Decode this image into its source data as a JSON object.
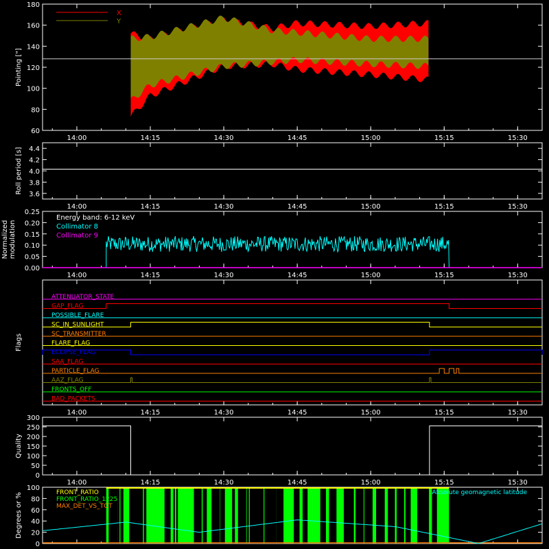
{
  "colors": {
    "axis": "#ffffff",
    "x": "#ff0000",
    "y": "#808000",
    "cyan": "#00ffff",
    "magenta": "#ff00ff",
    "green": "#00ff00",
    "yellow": "#ffff00",
    "orange": "#ff8000"
  },
  "time_ticks": [
    "14:00",
    "14:15",
    "14:30",
    "14:45",
    "15:00",
    "15:15",
    "15:30"
  ],
  "chart_data": [
    {
      "type": "line",
      "id": "pointing",
      "ylabel": "Pointing [\"]",
      "ylim": [
        60,
        180
      ],
      "yticks": [
        60,
        80,
        100,
        120,
        140,
        160,
        180
      ],
      "legend": [
        "X",
        "Y"
      ],
      "legend_placement": "top-left",
      "reference_level": 128,
      "data_range": [
        "14:11",
        "15:12"
      ],
      "series": [
        {
          "name": "X",
          "x": [
            "14:11",
            "14:15",
            "14:30",
            "14:40",
            "14:45",
            "15:00",
            "15:12"
          ],
          "min": [
            70,
            90,
            118,
            120,
            115,
            110,
            105
          ],
          "max": [
            155,
            150,
            168,
            160,
            165,
            162,
            165
          ]
        },
        {
          "name": "Y",
          "x": [
            "14:11",
            "14:15",
            "14:30",
            "14:40",
            "14:45",
            "15:00",
            "15:12"
          ],
          "min": [
            85,
            100,
            118,
            122,
            124,
            120,
            118
          ],
          "max": [
            150,
            152,
            170,
            158,
            156,
            150,
            150
          ]
        }
      ]
    },
    {
      "type": "line",
      "id": "roll",
      "ylabel": "Roll period [s]",
      "ylim": [
        3.5,
        4.5
      ],
      "yticks": [
        "3.6",
        "3.8",
        "4.0",
        "4.2",
        "4.4"
      ],
      "value": 4.03
    },
    {
      "type": "line",
      "id": "modulation",
      "ylabel": "Normalized modulation",
      "ylabel_lines": [
        "Normalized",
        "modulation"
      ],
      "ylim": [
        0,
        0.25
      ],
      "yticks": [
        "0.00",
        "0.05",
        "0.10",
        "0.15",
        "0.20",
        "0.25"
      ],
      "annotation": "Energy band: 6-12 keV",
      "series": [
        {
          "name": "Collimator 8",
          "x": [
            "14:06",
            "15:16"
          ],
          "mean": 0.105,
          "spread": 0.035
        },
        {
          "name": "Collimator 9",
          "value": 0
        }
      ]
    },
    {
      "type": "line",
      "id": "flags",
      "ylabel": "Flags",
      "series": [
        {
          "name": "ATTENUATOR_STATE",
          "color": "#ff00ff",
          "steps": []
        },
        {
          "name": "GAP_FLAG",
          "color": "#ff0000",
          "steps": [
            [
              "14:06",
              "15:16"
            ]
          ]
        },
        {
          "name": "POSSIBLE_FLARE",
          "color": "#00ffff",
          "steps": []
        },
        {
          "name": "SC_IN_SUNLIGHT",
          "color": "#ffff00",
          "steps": [
            [
              "14:11",
              "15:12"
            ]
          ]
        },
        {
          "name": "SC_TRANSMITTER",
          "color": "#ff8000",
          "steps": []
        },
        {
          "name": "FLARE_FLAG",
          "color": "#ffff00",
          "steps": []
        },
        {
          "name": "ECLIPSE_FLAG",
          "color": "#0000ff",
          "steps": [
            [
              "00:00",
              "14:11"
            ],
            [
              "15:12",
              "23:59"
            ]
          ]
        },
        {
          "name": "SAA_FLAG",
          "color": "#ff0000",
          "steps": []
        },
        {
          "name": "PARTICLE_FLAG",
          "color": "#ff8000",
          "steps": [
            [
              "15:14",
              "15:15"
            ],
            [
              "15:16",
              "15:17"
            ],
            [
              "15:17.5",
              "15:18"
            ]
          ]
        },
        {
          "name": "AAZ_FLAG",
          "color": "#808000",
          "steps": [
            [
              "14:11",
              "14:11.3"
            ],
            [
              "15:12",
              "15:12.3"
            ]
          ]
        },
        {
          "name": "FRONTS_OFF",
          "color": "#00ff00",
          "steps": []
        },
        {
          "name": "BAD_PACKETS",
          "color": "#ff0000",
          "steps": []
        }
      ]
    },
    {
      "type": "line",
      "id": "quality",
      "ylabel": "Quality",
      "ylim": [
        0,
        300
      ],
      "yticks": [
        0,
        50,
        100,
        150,
        200,
        250,
        300
      ],
      "series": [
        {
          "name": "Quality",
          "high": 255,
          "low_range": [
            "14:11",
            "15:12"
          ]
        }
      ]
    },
    {
      "type": "area",
      "id": "degrees",
      "ylabel": "Degrees or %",
      "ylim": [
        0,
        100
      ],
      "yticks": [
        0,
        20,
        40,
        60,
        80,
        100
      ],
      "legend": [
        "FRONT_RATIO",
        "FRONT_RATIO_1225",
        "MAX_DET_VS_TOT"
      ],
      "legend_right": "Absolute geomagnetic latitude",
      "front_ratio_range": [
        "14:06",
        "15:16"
      ],
      "latitude": {
        "x": [
          "13:50",
          "14:10",
          "14:25",
          "14:45",
          "15:05",
          "15:22",
          "15:35"
        ],
        "y": [
          20,
          38,
          20,
          42,
          30,
          0,
          35
        ]
      }
    }
  ]
}
